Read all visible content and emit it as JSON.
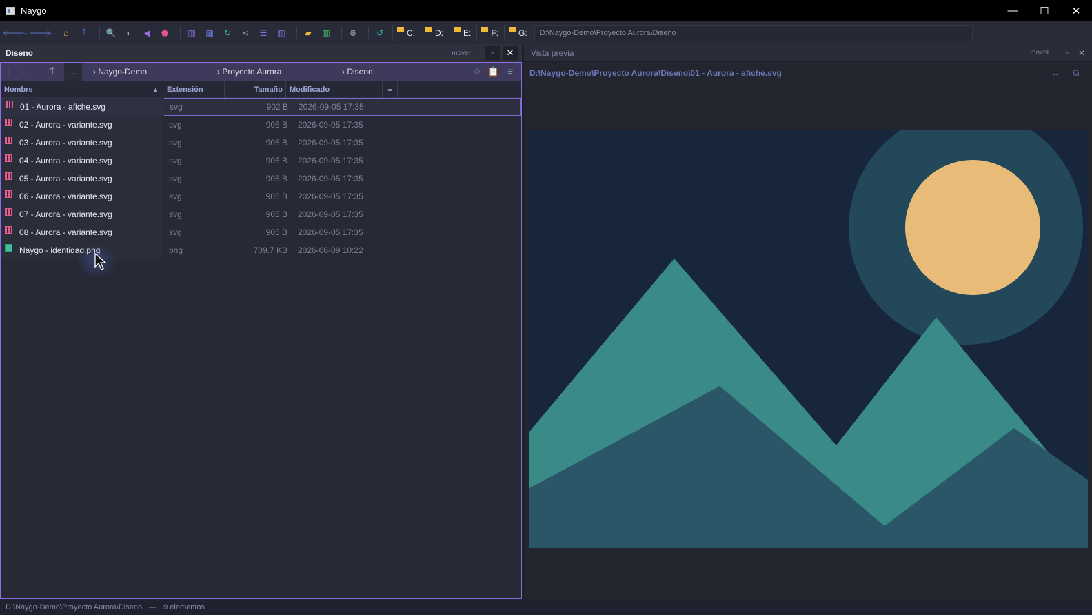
{
  "window": {
    "title": "Naygo",
    "minimize": "—",
    "maximize": "☐",
    "close": "✕"
  },
  "toolbar": {
    "icons": [
      {
        "name": "back-icon",
        "glyph": "🡐",
        "color": "#5b6fc4"
      },
      {
        "name": "back-history-icon",
        "glyph": "⌄",
        "color": "#6f7590"
      },
      {
        "name": "forward-icon",
        "glyph": "🡒",
        "color": "#5b6fc4"
      },
      {
        "name": "forward-history-icon",
        "glyph": "⌄",
        "color": "#6f7590"
      },
      {
        "name": "home-icon",
        "glyph": "⌂",
        "color": "#f0b838"
      },
      {
        "name": "up-icon",
        "glyph": "🡑",
        "color": "#4a8be8"
      },
      {
        "name": "search-icon",
        "glyph": "🔍",
        "color": "#4a8be8"
      },
      {
        "name": "theme-icon",
        "glyph": "◐",
        "color": "#9aa0b8"
      },
      {
        "name": "bookmark-left-icon",
        "glyph": "◀",
        "color": "#9a6ee0"
      },
      {
        "name": "favorites-icon",
        "glyph": "⬟",
        "color": "#e4568a"
      },
      {
        "name": "columns-view-icon",
        "glyph": "▥",
        "color": "#8a6fe0"
      },
      {
        "name": "grid-view-icon",
        "glyph": "▦",
        "color": "#6f84e8"
      },
      {
        "name": "sync-icon",
        "glyph": "↻",
        "color": "#30b6a6"
      },
      {
        "name": "share-icon",
        "glyph": "⋖",
        "color": "#9aa0b8"
      },
      {
        "name": "list-view-icon",
        "glyph": "☰",
        "color": "#8a6fe0"
      },
      {
        "name": "panels-view-icon",
        "glyph": "▥",
        "color": "#8a6fe0"
      },
      {
        "name": "archive-icon",
        "glyph": "▰",
        "color": "#f0b838"
      },
      {
        "name": "split-view-icon",
        "glyph": "▥",
        "color": "#3fbf6a"
      },
      {
        "name": "settings-icon",
        "glyph": "⚙",
        "color": "#9aa0b8"
      },
      {
        "name": "refresh-icon",
        "glyph": "↺",
        "color": "#30b6a6"
      }
    ],
    "drives": [
      "C:",
      "D:",
      "E:",
      "F:",
      "G:"
    ],
    "path": "D:\\Naygo-Demo\\Proyecto Aurora\\Diseno"
  },
  "left_pane": {
    "title": "Diseno",
    "move_label": "mover",
    "maximize_glyph": "▫",
    "close_glyph": "✕",
    "breadcrumb": {
      "back": "‹",
      "forward": "›",
      "up": "🡑",
      "more": "…",
      "crumbs": [
        "› Naygo-Demo",
        "› Proyecto Aurora",
        "› Diseno"
      ],
      "star": "☆",
      "clipboard": "📋",
      "filter": "☰"
    },
    "columns": {
      "name": "Nombre",
      "sort": "▲",
      "extension": "Extensión",
      "size": "Tamaño",
      "modified": "Modificado",
      "menu": "≡"
    },
    "files": [
      {
        "name": "01 - Aurora - afiche.svg",
        "ext": "svg",
        "size": "902 B",
        "date": "2026-09-05 17:35",
        "type": "svg",
        "selected": true
      },
      {
        "name": "02 - Aurora - variante.svg",
        "ext": "svg",
        "size": "905 B",
        "date": "2026-09-05 17:35",
        "type": "svg"
      },
      {
        "name": "03 - Aurora - variante.svg",
        "ext": "svg",
        "size": "905 B",
        "date": "2026-09-05 17:35",
        "type": "svg"
      },
      {
        "name": "04 - Aurora - variante.svg",
        "ext": "svg",
        "size": "905 B",
        "date": "2026-09-05 17:35",
        "type": "svg"
      },
      {
        "name": "05 - Aurora - variante.svg",
        "ext": "svg",
        "size": "905 B",
        "date": "2026-09-05 17:35",
        "type": "svg"
      },
      {
        "name": "06 - Aurora - variante.svg",
        "ext": "svg",
        "size": "905 B",
        "date": "2026-09-05 17:35",
        "type": "svg"
      },
      {
        "name": "07 - Aurora - variante.svg",
        "ext": "svg",
        "size": "905 B",
        "date": "2026-09-05 17:35",
        "type": "svg"
      },
      {
        "name": "08 - Aurora - variante.svg",
        "ext": "svg",
        "size": "905 B",
        "date": "2026-09-05 17:35",
        "type": "svg"
      },
      {
        "name": "Naygo - identidad.png",
        "ext": "png",
        "size": "709.7 KB",
        "date": "2026-06-09 10:22",
        "type": "png"
      }
    ]
  },
  "right_pane": {
    "title": "Vista previa",
    "move_label": "mover",
    "maximize_glyph": "▫",
    "close_glyph": "✕",
    "file_path": "D:\\Naygo-Demo\\Proyecto Aurora\\Diseno\\01 - Aurora - afiche.svg",
    "fit_glyph": "↔",
    "open_external_glyph": "⧉",
    "preview_colors": {
      "sky": "#17263a",
      "halo": "#23485a",
      "sun": "#e8bb78",
      "mountain_light": "#3a8a88",
      "mountain_dark": "#2a5668"
    }
  },
  "status": {
    "path": "D:\\Naygo-Demo\\Proyecto Aurora\\Diseno",
    "separator": "—",
    "count": "9 elementos"
  }
}
